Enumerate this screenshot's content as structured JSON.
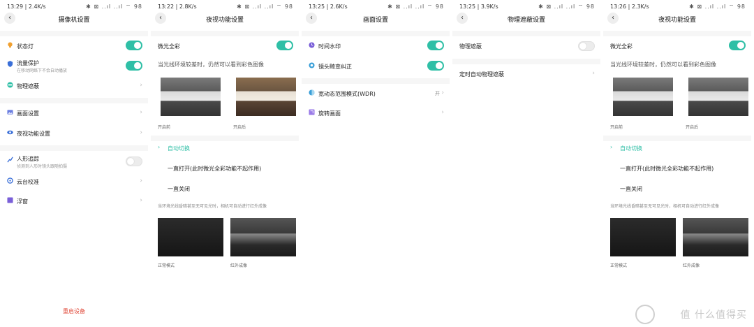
{
  "panels": [
    {
      "status": {
        "time": "13:29 | 2.4K/s",
        "icons": "✱ ⊠ ..ıl ..ıl ⌔ 98"
      },
      "title": "摄像机设置",
      "items": [
        {
          "label": "状态灯"
        },
        {
          "label": "流量保护",
          "sub": "在移动网络下不会自动播放"
        },
        {
          "label": "物理遮蔽"
        },
        {
          "label": "画面设置"
        },
        {
          "label": "夜视功能设置"
        },
        {
          "label": "人形追踪",
          "sub": "侦测到人形时镜头跟随拍摄"
        },
        {
          "label": "云台校准"
        },
        {
          "label": "浮窗"
        }
      ],
      "restart": "重启设备"
    },
    {
      "status": {
        "time": "13:22 | 2.8K/s",
        "icons": "✱ ⊠ ..ıl ..ıl ⌔ 98"
      },
      "title": "夜视功能设置",
      "fullcolor": "微光全彩",
      "desc": "当光线环境较差时，仍然可以看到彩色图像",
      "before": "开启前",
      "after": "开启后",
      "options": [
        "自动切换",
        "一直打开(此时微光全彩功能不起作用)",
        "一直关闭"
      ],
      "note": "当环境光线昏暗甚至无可见光时，相机可自动进行红外成像",
      "normal": "正常模式",
      "ir": "红外成像"
    },
    {
      "status": {
        "time": "13:25 | 2.6K/s",
        "icons": "✱ ⊠ ..ıl ..ıl ⌔ 98"
      },
      "title": "画面设置",
      "items": [
        {
          "label": "时间水印"
        },
        {
          "label": "镜头畸变纠正"
        },
        {
          "label": "宽动态范围模式(WDR)",
          "value": "开"
        },
        {
          "label": "旋转画面"
        }
      ]
    },
    {
      "status": {
        "time": "13:25 | 3.9K/s",
        "icons": "✱ ⊠ ..ıl ..ıl ⌔ 98"
      },
      "title": "物理遮蔽设置",
      "items": [
        {
          "label": "物理遮蔽"
        },
        {
          "label": "定时自动物理遮蔽"
        }
      ]
    },
    {
      "status": {
        "time": "13:26 | 2.3K/s",
        "icons": "✱ ⊠ ..ıl ..ıl ⌔ 98"
      },
      "title": "夜视功能设置",
      "fullcolor": "微光全彩",
      "desc": "当光线环境较差时，仍然可以看到彩色图像",
      "before": "开启前",
      "after": "开启后",
      "options": [
        "自动切换",
        "一直打开(此时微光全彩功能不起作用)",
        "一直关闭"
      ],
      "note": "当环境光线昏暗甚至无可见光时，相机可自动进行红外成像",
      "normal": "正常模式",
      "ir": "红外成像"
    }
  ],
  "watermark": "值 什么值得买",
  "colors": {
    "accent": "#2fbfa6",
    "danger": "#e04a3a"
  }
}
